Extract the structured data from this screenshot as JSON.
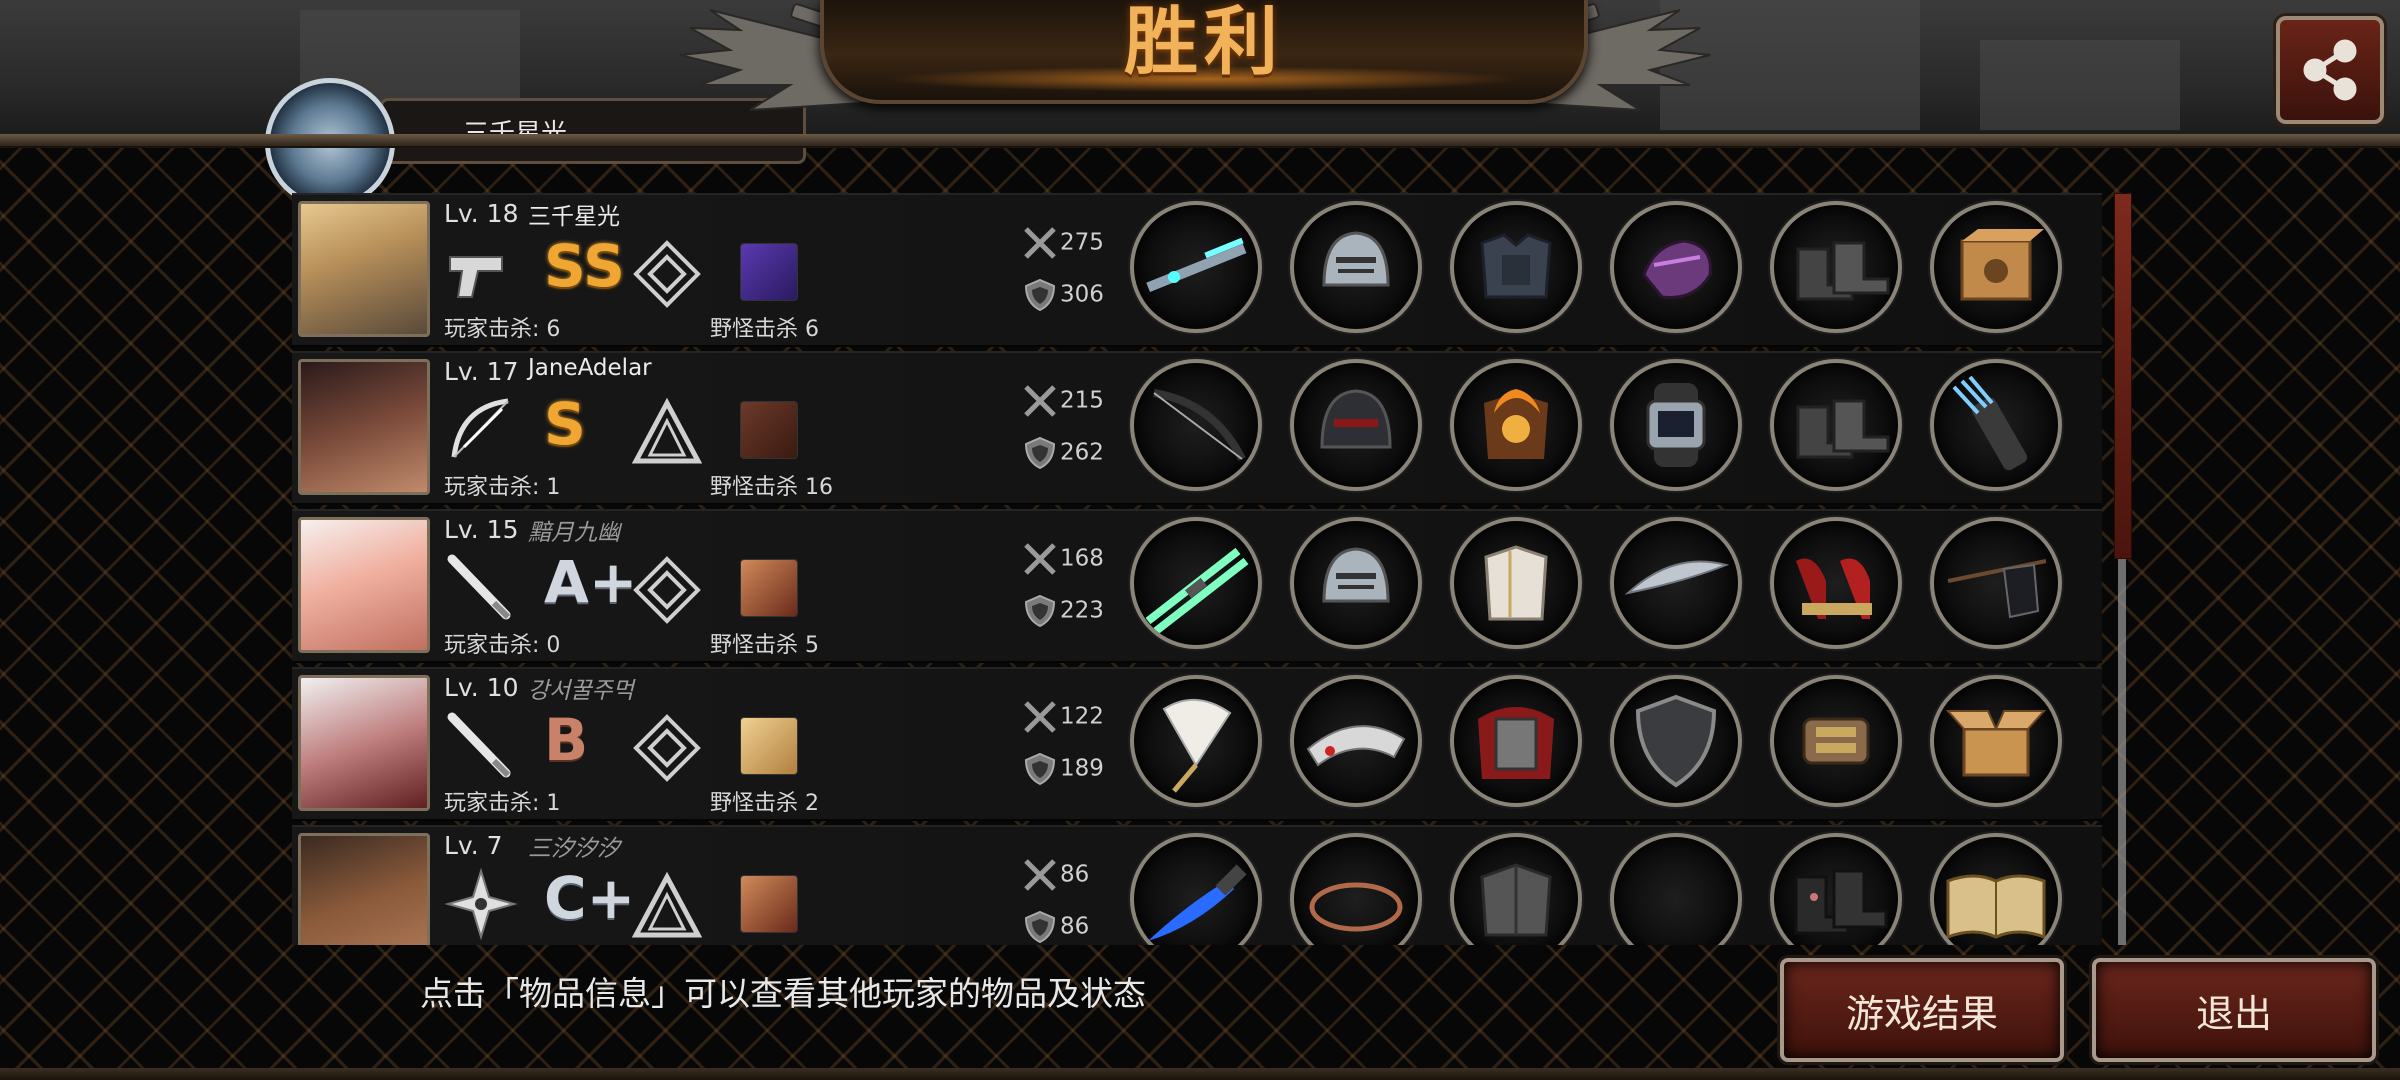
{
  "header": {
    "title": "胜利",
    "share_icon": "share-icon",
    "my_name_partial": "三千星光"
  },
  "players": [
    {
      "level": "Lv. 18",
      "name": "三千星光",
      "name_style": "normal",
      "weapon_icon": "pistol-icon",
      "grade": "SS",
      "grade_color": "gold",
      "rank_icon": "diamond-rank-icon",
      "monster_icon": "purple-monster-icon",
      "player_kills": "玩家击杀: 6",
      "monster_kills": "野怪击杀 6",
      "attack": "275",
      "defense": "306",
      "items": [
        "laser-rifle-icon",
        "steel-helmet-icon",
        "dark-armor-icon",
        "purple-gauntlet-icon",
        "combat-boots-icon",
        "supply-crate-icon"
      ]
    },
    {
      "level": "Lv. 17",
      "name": "JaneAdelar",
      "name_style": "normal",
      "weapon_icon": "bow-icon",
      "grade": "S",
      "grade_color": "gold",
      "rank_icon": "triangle-rank-icon",
      "monster_icon": "crossed-monster-icon",
      "player_kills": "玩家击杀: 1",
      "monster_kills": "野怪击杀 16",
      "attack": "215",
      "defense": "262",
      "items": [
        "black-bow-icon",
        "black-helmet-icon",
        "fire-armor-icon",
        "digital-watch-icon",
        "combat-boots-icon",
        "arrow-quiver-icon"
      ]
    },
    {
      "level": "Lv. 15",
      "name": "黯月九幽",
      "name_style": "gray",
      "weapon_icon": "bat-icon",
      "grade": "A+",
      "grade_color": "silver",
      "rank_icon": "diamond-rank-icon",
      "monster_icon": "sunglasses-monster-icon",
      "player_kills": "玩家击杀: 0",
      "monster_kills": "野怪击杀 5",
      "attack": "168",
      "defense": "223",
      "items": [
        "twin-lightsaber-icon",
        "steel-helmet-icon",
        "white-robe-icon",
        "silver-feather-icon",
        "red-heels-icon",
        "black-flag-icon"
      ]
    },
    {
      "level": "Lv. 10",
      "name": "강서꿀주먹",
      "name_style": "gray",
      "weapon_icon": "bat-icon",
      "grade": "B",
      "grade_color": "bronze",
      "rank_icon": "diamond-rank-icon",
      "monster_icon": "gold-monster-icon",
      "player_kills": "玩家击杀: 1",
      "monster_kills": "野怪击杀 2",
      "attack": "122",
      "defense": "189",
      "items": [
        "paper-fan-icon",
        "silver-tiara-icon",
        "red-cape-armor-icon",
        "dark-shield-icon",
        "gear-bracer-icon",
        "open-box-icon"
      ]
    },
    {
      "level": "Lv. 7",
      "name": "三汐汐汐",
      "name_style": "gray",
      "weapon_icon": "shuriken-icon",
      "grade": "C+",
      "grade_color": "silver",
      "rank_icon": "triangle-rank-icon",
      "monster_icon": "sunglasses-monster-icon",
      "player_kills": "",
      "monster_kills": "",
      "attack": "86",
      "defense": "86",
      "items": [
        "blue-dagger-icon",
        "bronze-ring-icon",
        "gray-jacket-icon",
        "empty-slot",
        "floral-boots-icon",
        "old-book-icon"
      ]
    }
  ],
  "footer": {
    "hint": "点击「物品信息」可以查看其他玩家的物品及状态",
    "result_button": "游戏结果",
    "exit_button": "退出"
  }
}
